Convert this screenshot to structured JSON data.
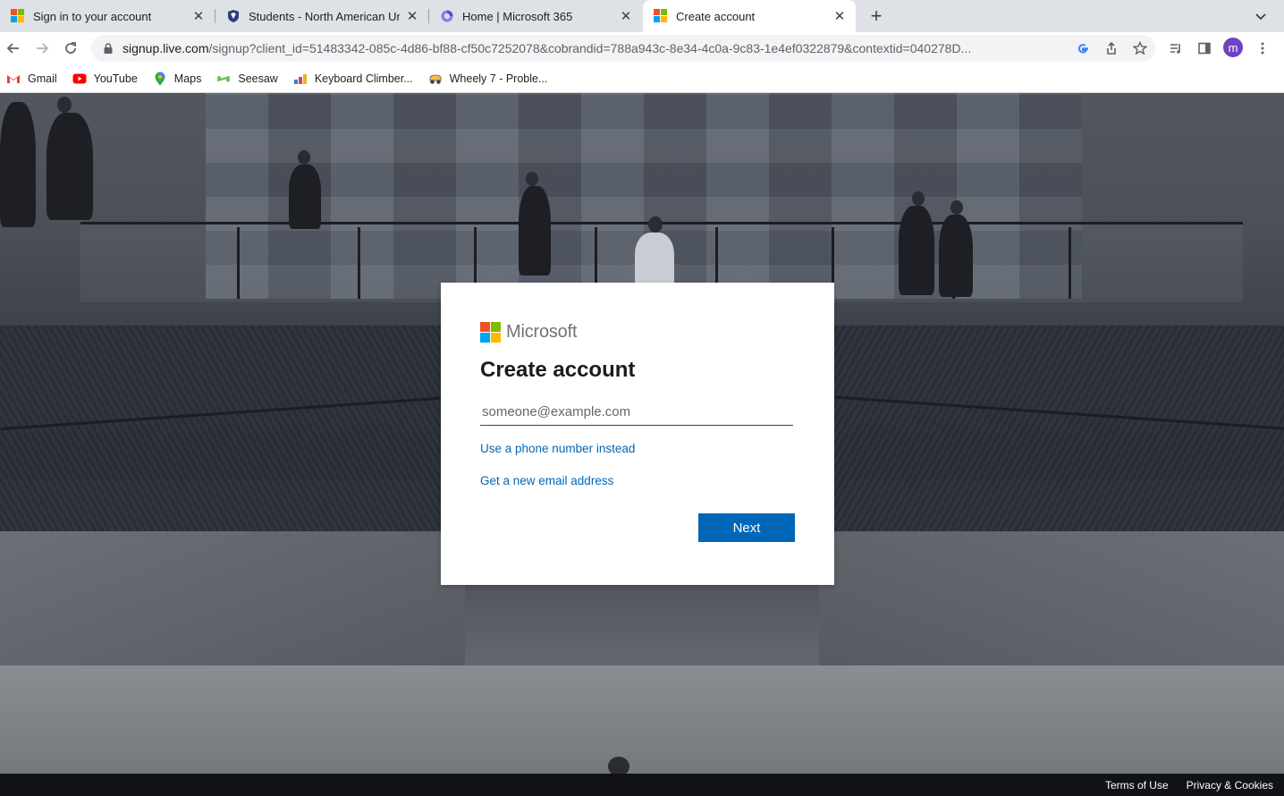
{
  "browser": {
    "tabs": [
      {
        "title": "Sign in to your account",
        "icon": "microsoft-logo",
        "active": false
      },
      {
        "title": "Students - North American Uni",
        "icon": "university-shield",
        "active": false
      },
      {
        "title": "Home | Microsoft 365",
        "icon": "microsoft-365-logo",
        "active": false
      },
      {
        "title": "Create account",
        "icon": "microsoft-logo",
        "active": true
      }
    ],
    "new_tab": "+",
    "url_host": "signup.live.com",
    "url_path": "/signup?client_id=51483342-085c-4d86-bf88-cf50c7252078&cobrandid=788a943c-8e34-4c0a-9c83-1e4ef0322879&contextid=040278D...",
    "profile_initial": "m"
  },
  "bookmarks": [
    {
      "label": "Gmail",
      "icon": "gmail-icon"
    },
    {
      "label": "YouTube",
      "icon": "youtube-icon"
    },
    {
      "label": "Maps",
      "icon": "maps-icon"
    },
    {
      "label": "Seesaw",
      "icon": "seesaw-icon"
    },
    {
      "label": "Keyboard Climber...",
      "icon": "keyboard-climber-icon"
    },
    {
      "label": "Wheely 7 - Proble...",
      "icon": "wheely-icon"
    }
  ],
  "signup": {
    "brand": "Microsoft",
    "heading": "Create account",
    "email_placeholder": "someone@example.com",
    "email_value": "",
    "phone_link": "Use a phone number instead",
    "new_email_link": "Get a new email address",
    "next_button": "Next"
  },
  "footer": {
    "terms": "Terms of Use",
    "privacy": "Privacy & Cookies"
  },
  "colors": {
    "accent": "#0067b8",
    "ms_red": "#f25022",
    "ms_green": "#7fba00",
    "ms_blue": "#00a4ef",
    "ms_yellow": "#ffb900"
  }
}
